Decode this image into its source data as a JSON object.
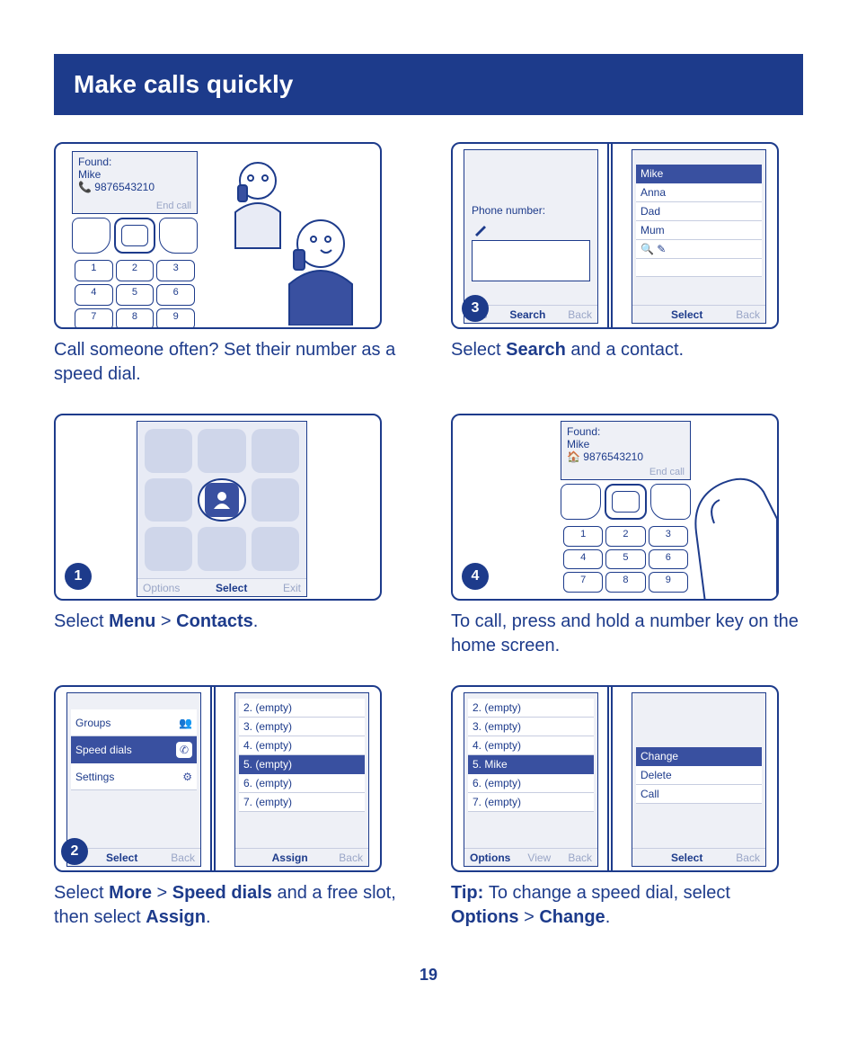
{
  "title": "Make calls quickly",
  "page_number": "19",
  "intro": {
    "found": "Found:",
    "name": "Mike",
    "number": "9876543210",
    "endcall": "End call",
    "keys": [
      "1",
      "2",
      "3",
      "4",
      "5",
      "6",
      "7",
      "8",
      "9"
    ],
    "caption_pre": "Call someone often? Set their number as a speed dial."
  },
  "step1": {
    "badge": "1",
    "soft_left": "Options",
    "soft_mid": "Select",
    "soft_right": "Exit",
    "caption_a": "Select ",
    "caption_menu": "Menu",
    "caption_gt": "  >  ",
    "caption_contacts": "Contacts",
    "caption_dot": "."
  },
  "step2": {
    "badge": "2",
    "left_items": [
      "Groups",
      "Speed dials",
      "Settings"
    ],
    "left_sel_index": 1,
    "left_soft_mid": "Select",
    "left_soft_right": "Back",
    "right_items": [
      "2. (empty)",
      "3. (empty)",
      "4. (empty)",
      "5. (empty)",
      "6. (empty)",
      "7. (empty)"
    ],
    "right_sel_index": 3,
    "right_soft_mid": "Assign",
    "right_soft_right": "Back",
    "caption_a": "Select ",
    "caption_more": "More",
    "caption_gt": "  >  ",
    "caption_speed": "Speed dials",
    "caption_b": " and a free slot, then select ",
    "caption_assign": "Assign",
    "caption_dot": "."
  },
  "step3": {
    "badge": "3",
    "left_label": "Phone number:",
    "left_soft_left": "ons",
    "left_soft_mid": "Search",
    "left_soft_right": "Back",
    "right_items": [
      "Mike",
      "Anna",
      "Dad",
      "Mum"
    ],
    "right_sel_index": 0,
    "right_soft_mid": "Select",
    "right_soft_right": "Back",
    "caption_a": "Select ",
    "caption_search": "Search",
    "caption_b": " and a contact."
  },
  "step4": {
    "badge": "4",
    "found": "Found:",
    "name": "Mike",
    "number": "9876543210",
    "endcall": "End call",
    "keys": [
      "1",
      "2",
      "3",
      "4",
      "5",
      "6",
      "7",
      "8",
      "9"
    ],
    "caption": "To call, press and hold a number key on the home screen."
  },
  "tip": {
    "left_items": [
      "2. (empty)",
      "3. (empty)",
      "4. (empty)",
      "5. Mike",
      "6. (empty)",
      "7. (empty)"
    ],
    "left_sel_index": 3,
    "left_soft_left": "Options",
    "left_soft_mid": "View",
    "left_soft_right": "Back",
    "right_items": [
      "Change",
      "Delete",
      "Call"
    ],
    "right_sel_index": 0,
    "right_soft_mid": "Select",
    "right_soft_right": "Back",
    "caption_tip": "Tip: ",
    "caption_a": "To change a speed dial, select ",
    "caption_options": "Options",
    "caption_gt": "  >  ",
    "caption_change": "Change",
    "caption_dot": "."
  }
}
